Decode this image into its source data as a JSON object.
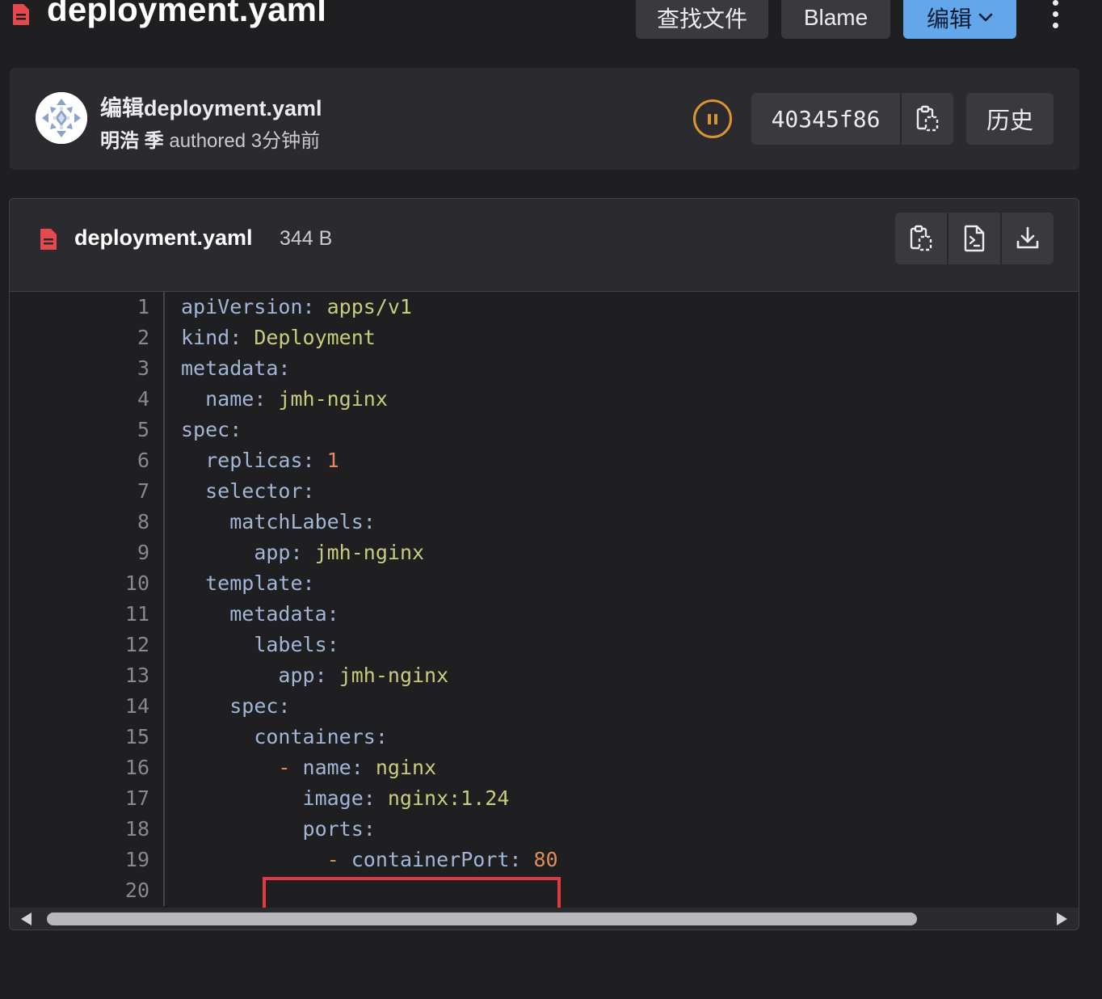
{
  "header": {
    "title": "deployment.yaml",
    "find_file_label": "查找文件",
    "blame_label": "Blame",
    "edit_label": "编辑"
  },
  "commit": {
    "title": "编辑deployment.yaml",
    "author": "明浩 季",
    "authored_text": "authored 3分钟前",
    "sha": "40345f86",
    "history_label": "历史",
    "pipeline_status": "paused"
  },
  "file": {
    "name": "deployment.yaml",
    "size": "344 B"
  },
  "code_lines": [
    {
      "no": "1",
      "key": "apiVersion:",
      "val": " apps/v1",
      "indent": ""
    },
    {
      "no": "2",
      "key": "kind:",
      "val": " Deployment",
      "indent": ""
    },
    {
      "no": "3",
      "key": "metadata:",
      "val": "",
      "indent": ""
    },
    {
      "no": "4",
      "key": "name:",
      "val": " jmh-nginx",
      "indent": "  "
    },
    {
      "no": "5",
      "key": "spec:",
      "val": "",
      "indent": ""
    },
    {
      "no": "6",
      "key": "replicas:",
      "val": " 1",
      "indent": "  "
    },
    {
      "no": "7",
      "key": "selector:",
      "val": "",
      "indent": "  "
    },
    {
      "no": "8",
      "key": "matchLabels:",
      "val": "",
      "indent": "    "
    },
    {
      "no": "9",
      "key": "app:",
      "val": " jmh-nginx",
      "indent": "      "
    },
    {
      "no": "10",
      "key": "template:",
      "val": "",
      "indent": "  "
    },
    {
      "no": "11",
      "key": "metadata:",
      "val": "",
      "indent": "    "
    },
    {
      "no": "12",
      "key": "labels:",
      "val": "",
      "indent": "      "
    },
    {
      "no": "13",
      "key": "app:",
      "val": " jmh-nginx",
      "indent": "        "
    },
    {
      "no": "14",
      "key": "spec:",
      "val": "",
      "indent": "    "
    },
    {
      "no": "15",
      "key": "containers:",
      "val": "",
      "indent": "      "
    },
    {
      "no": "16",
      "key": "name:",
      "val": " nginx",
      "indent": "        ",
      "dash": "- "
    },
    {
      "no": "17",
      "key": "image:",
      "val": " nginx:1.24",
      "indent": "          "
    },
    {
      "no": "18",
      "key": "ports:",
      "val": "",
      "indent": "          "
    },
    {
      "no": "19",
      "key": "containerPort:",
      "val": " 80",
      "indent": "            ",
      "dash": "- ",
      "numeric": true
    },
    {
      "no": "20",
      "key": "",
      "val": "",
      "indent": ""
    }
  ],
  "colors": {
    "accent_blue": "#63a6e9",
    "pipeline_orange": "#d99530",
    "highlight_red": "#e23a45",
    "file_icon_red": "#e5484d"
  },
  "icons": {
    "file": "file-code-icon",
    "copy": "copy-to-clipboard-icon",
    "raw": "file-raw-icon",
    "download": "download-icon",
    "chevron": "chevron-down-icon",
    "more": "ellipsis-v-icon",
    "pipeline": "status-paused-icon"
  }
}
